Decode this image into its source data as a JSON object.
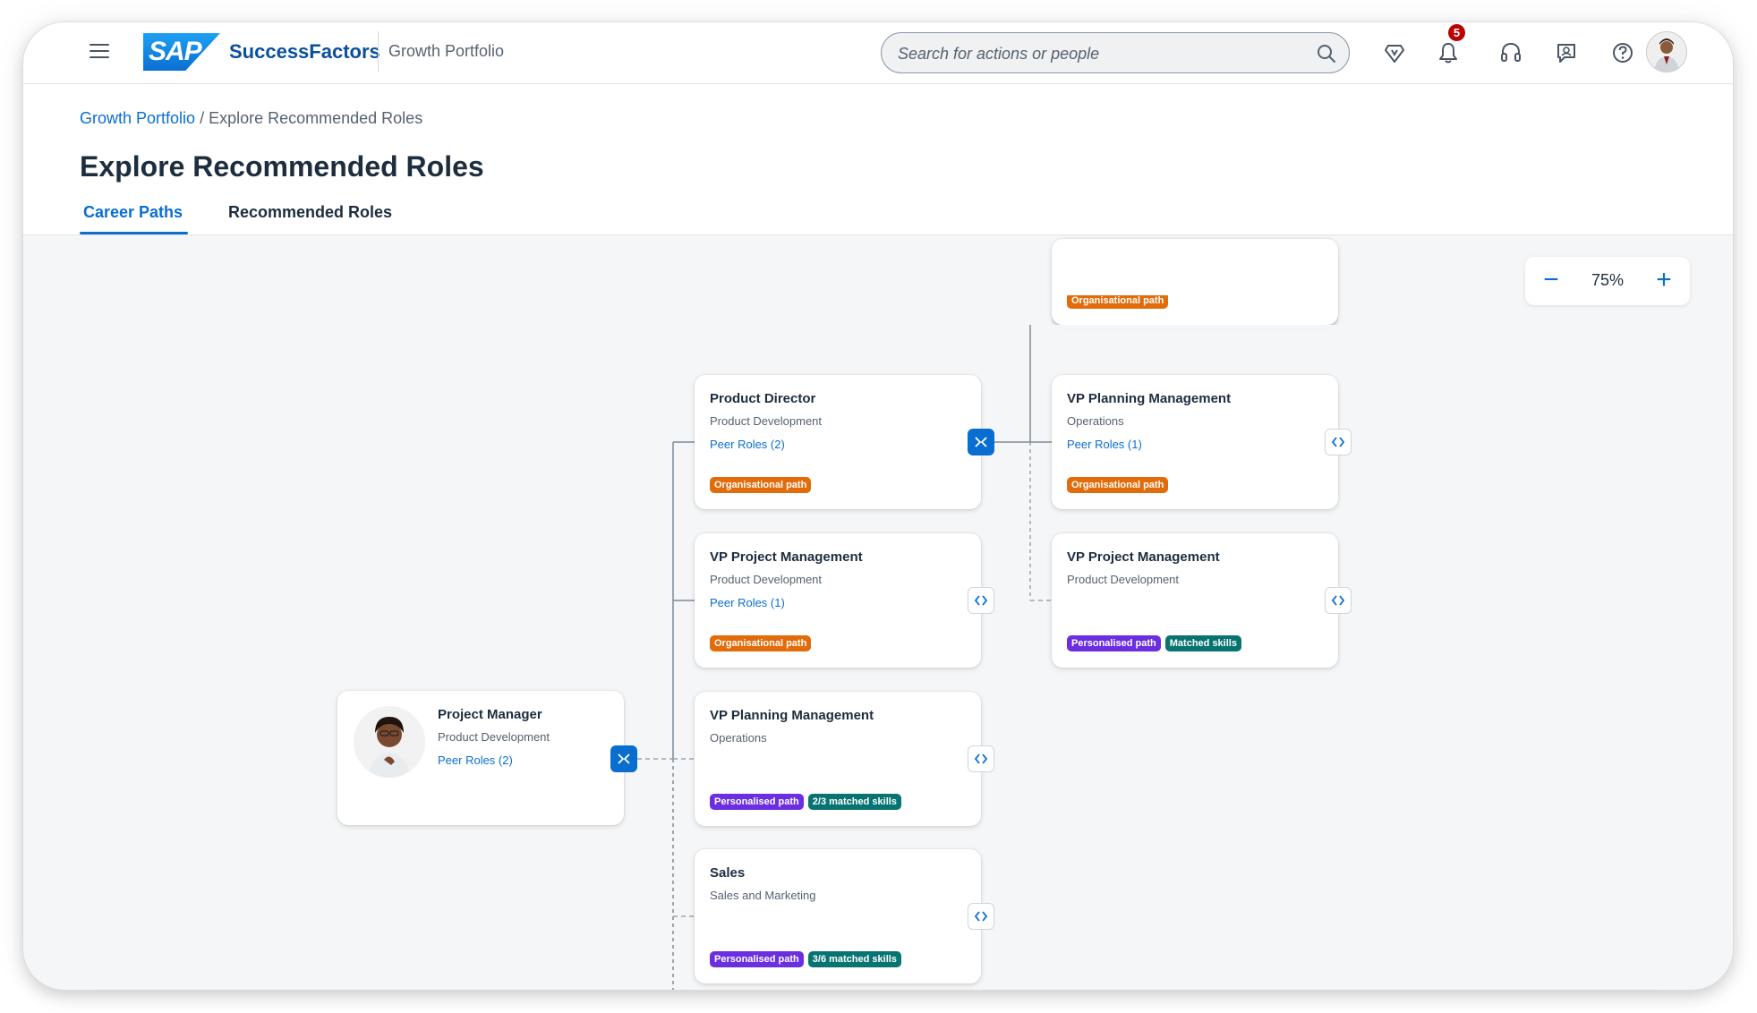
{
  "shell": {
    "brand": "SAP",
    "product": "SuccessFactors",
    "section": "Growth Portfolio",
    "search_placeholder": "Search for actions or people",
    "notification_count": "5"
  },
  "breadcrumb": {
    "root": "Growth Portfolio",
    "separator": " / ",
    "current": "Explore Recommended Roles"
  },
  "page": {
    "title": "Explore Recommended Roles",
    "tabs": [
      "Career Paths",
      "Recommended Roles"
    ]
  },
  "zoom": {
    "minus": "−",
    "value": "75%",
    "plus": "+"
  },
  "tags": {
    "org": "Organisational path",
    "personalised": "Personalised path",
    "matched": "Matched skills"
  },
  "cards": {
    "current": {
      "title": "Project Manager",
      "sub": "Product Development",
      "peer": "Peer Roles (2)"
    },
    "product_director": {
      "title": "Product Director",
      "sub": "Product Development",
      "peer": "Peer Roles (2)",
      "tag": "Organisational path"
    },
    "vp_project_1": {
      "title": "VP Project Management",
      "sub": "Product Development",
      "peer": "Peer Roles (1)",
      "tag": "Organisational path"
    },
    "vp_planning_1": {
      "title": "VP Planning Management",
      "sub": "Operations",
      "tag1": "Personalised path",
      "tag2": "2/3 matched skills"
    },
    "sales": {
      "title": "Sales",
      "sub": "Sales and Marketing",
      "tag1": "Personalised path",
      "tag2": "3/6 matched skills"
    },
    "top_partial": {
      "tag": "Organisational path"
    },
    "vp_planning_2": {
      "title": "VP Planning Management",
      "sub": "Operations",
      "peer": "Peer Roles (1)",
      "tag": "Organisational path"
    },
    "vp_project_2": {
      "title": "VP Project Management",
      "sub": "Product Development",
      "tag1": "Personalised path",
      "tag2": "Matched skills"
    }
  },
  "colors": {
    "accent": "#0a6ed1",
    "org_tag": "#e26b0a",
    "personalised_tag": "#6b2ee0",
    "skills_tag": "#087472"
  }
}
